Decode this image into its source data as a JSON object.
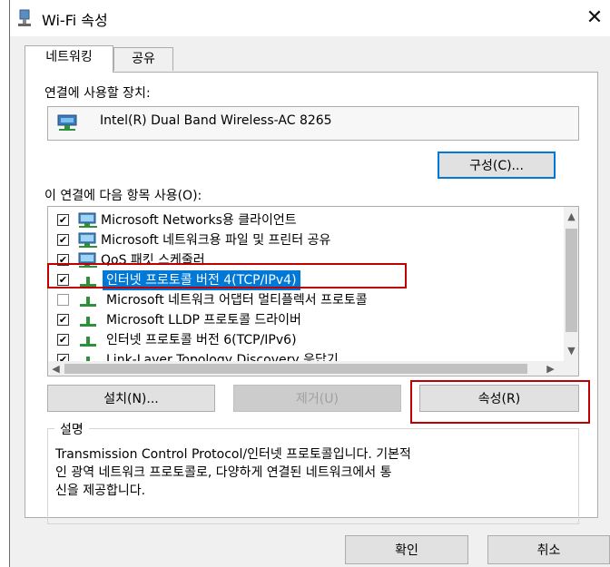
{
  "window": {
    "title": "Wi-Fi 속성",
    "close_glyph": "✕"
  },
  "tabs": [
    {
      "label": "네트워킹",
      "active": true
    },
    {
      "label": "공유",
      "active": false
    }
  ],
  "connect_using": {
    "label": "연결에 사용할 장치:",
    "device": "Intel(R) Dual Band Wireless-AC 8265",
    "configure_button": "구성(C)..."
  },
  "items_section": {
    "label": "이 연결에 다음 항목 사용(O):",
    "items": [
      {
        "label": "Microsoft Networks용 클라이언트",
        "checked": true,
        "icon": "network-client-icon"
      },
      {
        "label": "Microsoft 네트워크용 파일 및 프린터 공유",
        "checked": true,
        "icon": "network-share-icon"
      },
      {
        "label": "QoS 패킷 스케줄러",
        "checked": true,
        "icon": "network-qos-icon"
      },
      {
        "label": "인터넷 프로토콜 버전 4(TCP/IPv4)",
        "checked": true,
        "selected": true,
        "icon": "protocol-icon"
      },
      {
        "label": "Microsoft 네트워크 어댑터 멀티플렉서 프로토콜",
        "checked": false,
        "icon": "protocol-icon"
      },
      {
        "label": "Microsoft LLDP 프로토콜 드라이버",
        "checked": true,
        "icon": "protocol-icon"
      },
      {
        "label": "인터넷 프로토콜 버전 6(TCP/IPv6)",
        "checked": true,
        "icon": "protocol-icon"
      },
      {
        "label": "Link-Layer Topology Discovery 응답기",
        "checked": true,
        "icon": "protocol-icon"
      }
    ]
  },
  "buttons": {
    "install": "설치(N)...",
    "uninstall": "제거(U)",
    "properties": "속성(R)"
  },
  "description": {
    "title": "설명",
    "lines": [
      "Transmission Control Protocol/인터넷 프로토콜입니다. 기본적",
      "인 광역 네트워크 프로토콜로, 다양하게 연결된 네트워크에서 통",
      "신을 제공합니다."
    ]
  },
  "footer": {
    "ok": "확인",
    "cancel": "취소"
  },
  "colors": {
    "selection": "#0078d7",
    "highlight": "#c00000",
    "dialog_bg": "#f0f0f0"
  }
}
